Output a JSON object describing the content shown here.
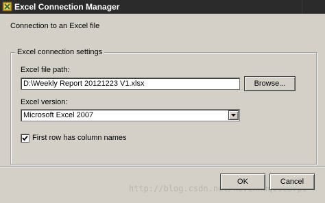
{
  "window": {
    "title": "Excel Connection Manager",
    "icon": "excel-connection-icon"
  },
  "main": {
    "subtitle": "Connection to an Excel file"
  },
  "settings": {
    "group_label": "Excel connection settings",
    "file_path_label": "Excel file path:",
    "file_path_value": "D:\\Weekly Report 20121223 V1.xlsx",
    "browse_label": "Browse...",
    "version_label": "Excel version:",
    "version_value": "Microsoft Excel 2007",
    "first_row_label": "First row has column names",
    "first_row_checked": true
  },
  "footer": {
    "ok_label": "OK",
    "cancel_label": "Cancel"
  },
  "watermark": "http://blog.csdn.net/kevinhuqiscorpi"
}
